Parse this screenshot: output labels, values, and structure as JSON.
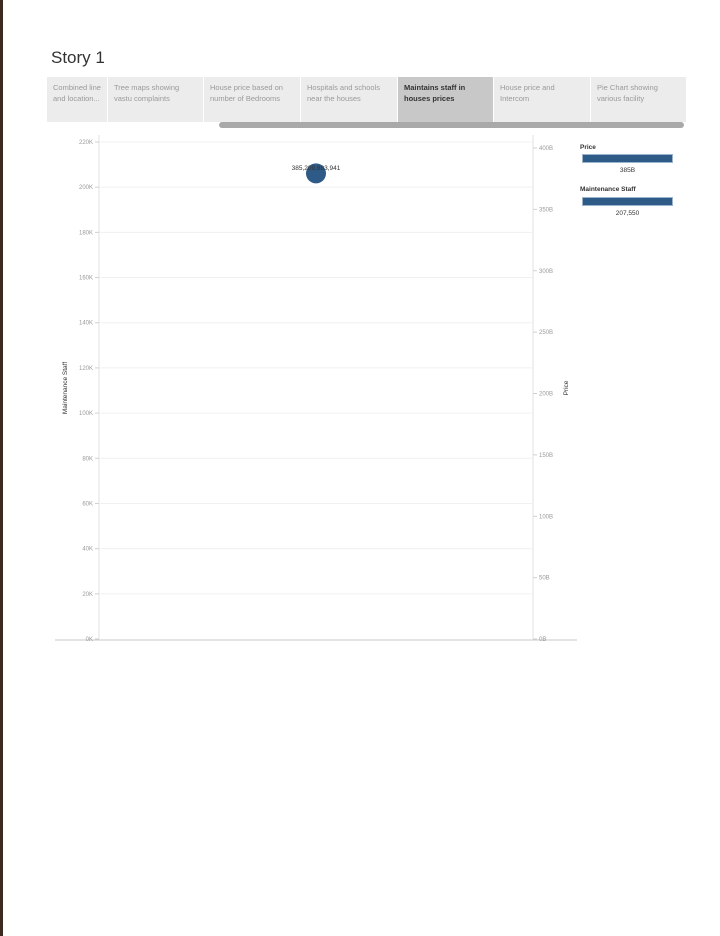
{
  "story": {
    "title": "Story 1"
  },
  "tabs": [
    {
      "label": "Combined line and location...",
      "active": false
    },
    {
      "label": "Tree maps showing vastu complaints",
      "active": false
    },
    {
      "label": "House price based on number of Bedrooms",
      "active": false
    },
    {
      "label": "Hospitals and schools near the houses",
      "active": false
    },
    {
      "label": "Maintains staff in houses prices",
      "active": true
    },
    {
      "label": "House price and Intercom",
      "active": false
    },
    {
      "label": "Pie Chart showing various facility",
      "active": false
    }
  ],
  "chart_data": {
    "type": "scatter",
    "y_left": {
      "label": "Maintenance Staff",
      "ticks": [
        "0K",
        "20K",
        "40K",
        "60K",
        "80K",
        "100K",
        "120K",
        "140K",
        "160K",
        "180K",
        "200K",
        "220K"
      ],
      "range": [
        0,
        220000
      ]
    },
    "y_right": {
      "label": "Price",
      "ticks": [
        "0B",
        "50B",
        "100B",
        "150B",
        "200B",
        "250B",
        "300B",
        "350B",
        "400B"
      ],
      "range": [
        0,
        400
      ]
    },
    "points": [
      {
        "maintenance_staff": 207550,
        "price_b": 385,
        "label": "385,209,883,941"
      }
    ],
    "point_color": "#2e5a87",
    "grid": true,
    "legend": [
      {
        "title": "Price",
        "value": "385B"
      },
      {
        "title": "Maintenance Staff",
        "value": "207,550"
      }
    ]
  }
}
